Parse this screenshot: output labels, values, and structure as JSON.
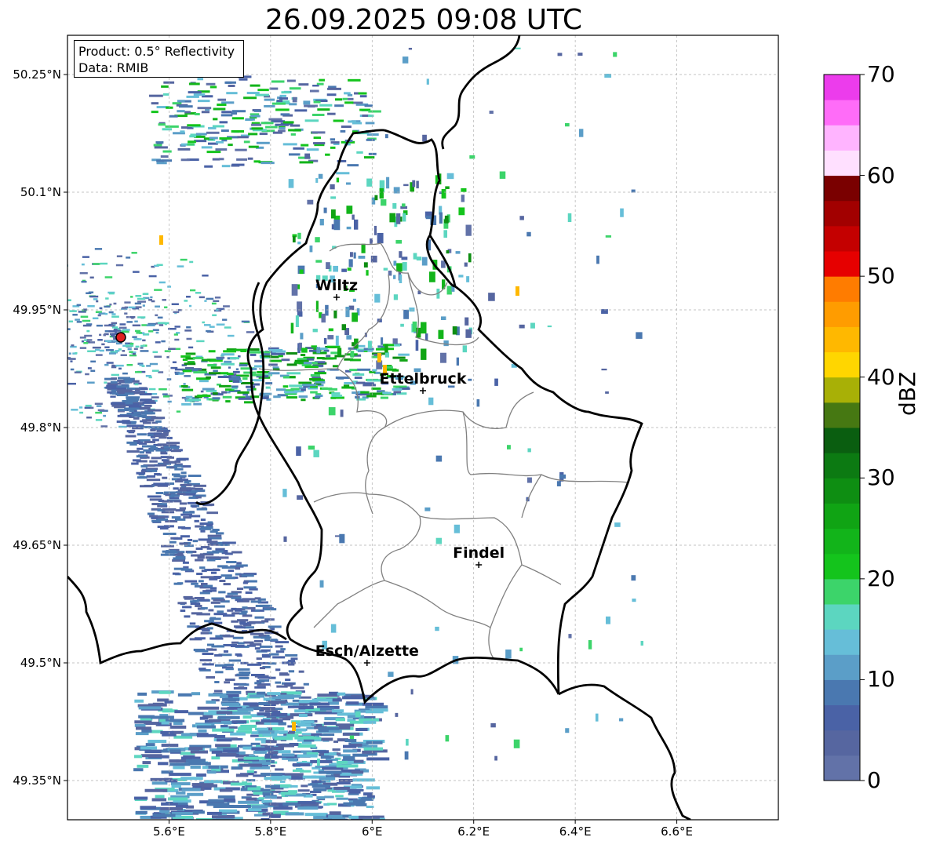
{
  "title": "26.09.2025 09:08 UTC",
  "info": {
    "product": "Product: 0.5° Reflectivity",
    "data": "Data: RMIB"
  },
  "axes": {
    "lat_labels": [
      "50.25°N",
      "50.1°N",
      "49.95°N",
      "49.8°N",
      "49.65°N",
      "49.5°N",
      "49.35°N"
    ],
    "lat_values": [
      50.25,
      50.1,
      49.95,
      49.8,
      49.65,
      49.5,
      49.35
    ],
    "lon_labels": [
      "5.6°E",
      "5.8°E",
      "6°E",
      "6.2°E",
      "6.4°E",
      "6.6°E"
    ],
    "lon_values": [
      5.6,
      5.8,
      6.0,
      6.2,
      6.4,
      6.6
    ],
    "lon_range": [
      5.4,
      6.8
    ],
    "lat_range": [
      49.3,
      50.3
    ],
    "grid": true
  },
  "cities": [
    {
      "name": "Wiltz",
      "lon": 5.93,
      "lat": 49.966
    },
    {
      "name": "Ettelbruck",
      "lon": 6.1,
      "lat": 49.847
    },
    {
      "name": "Findel",
      "lon": 6.21,
      "lat": 49.625
    },
    {
      "name": "Esch/Alzette",
      "lon": 5.99,
      "lat": 49.5
    }
  ],
  "radar_site": {
    "lon": 5.505,
    "lat": 49.915,
    "color": "#e02020"
  },
  "colorbar": {
    "label": "dBZ",
    "ticks": [
      "0",
      "10",
      "20",
      "30",
      "40",
      "50",
      "60",
      "70"
    ],
    "min": 0,
    "max": 70,
    "step": 2.5,
    "colors": [
      "#6272a8",
      "#5666a0",
      "#4a62a6",
      "#4a78b0",
      "#5b9ec8",
      "#66bed8",
      "#5cd6c0",
      "#3cd46a",
      "#14c41c",
      "#12b41a",
      "#10a414",
      "#0e8e12",
      "#0c7a12",
      "#0a5e10",
      "#467812",
      "#a8b006",
      "#ffd600",
      "#ffb800",
      "#ff9c00",
      "#ff7c00",
      "#e60000",
      "#c40000",
      "#a20000",
      "#7a0000",
      "#ffe0ff",
      "#ffb4ff",
      "#ff6cf8",
      "#ec3cec"
    ]
  },
  "colors": {
    "border_country": "#000000",
    "border_canton": "#808080",
    "grid": "#b0b0b0"
  }
}
